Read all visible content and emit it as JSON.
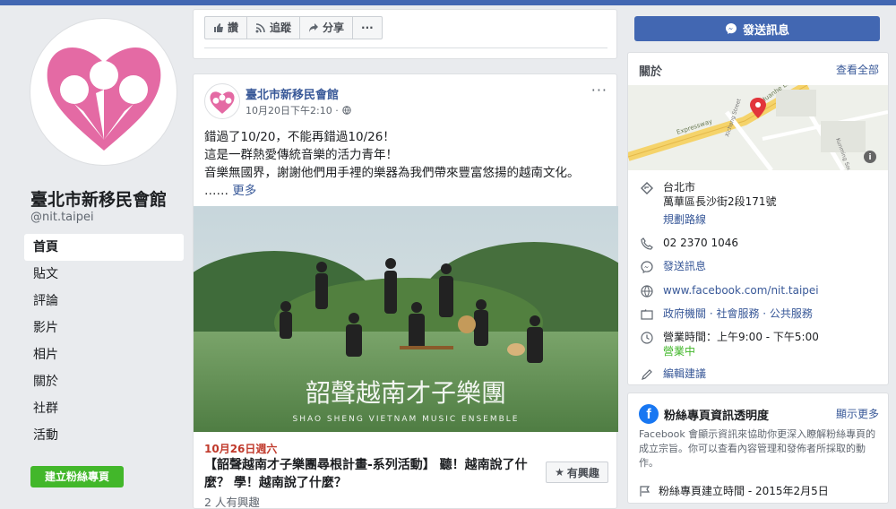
{
  "colors": {
    "brand": "#4267b2",
    "link": "#385898",
    "accent_pink": "#e46aa4",
    "green": "#42b72a",
    "event_red": "#c0392b"
  },
  "sidebar": {
    "page_name": "臺北市新移民會館",
    "handle": "@nit.taipei",
    "items": [
      {
        "label": "首頁"
      },
      {
        "label": "貼文"
      },
      {
        "label": "評論"
      },
      {
        "label": "影片"
      },
      {
        "label": "相片"
      },
      {
        "label": "關於"
      },
      {
        "label": "社群"
      },
      {
        "label": "活動"
      }
    ],
    "create_page": "建立粉絲專頁"
  },
  "actions": {
    "like": "讚",
    "follow": "追蹤",
    "share": "分享",
    "more": "···"
  },
  "post": {
    "author": "臺北市新移民會館",
    "time": "10月20日下午2:10 · ",
    "more": "···",
    "line1": "錯過了10/20，不能再錯過10/26！",
    "line2": "這是一群熱愛傳統音樂的活力青年！",
    "line3": "音樂無國界，謝謝他們用手裡的樂器為我們帶來豐富悠揚的越南文化。",
    "line4_prefix": "…… ",
    "line4_link": "更多",
    "image_title": "韶聲越南才子樂團",
    "image_subtitle": "SHAO SHENG VIETNAM MUSIC ENSEMBLE",
    "event_date": "10月26日週六",
    "event_title": "【韶聲越南才子樂團尋根計畫-系列活動】 聽！越南說了什麼？ 學！越南說了什麼？",
    "interest_btn": "有興趣",
    "interest_count": "2 人有興趣"
  },
  "right": {
    "message_btn": "發送訊息",
    "about_title": "關於",
    "see_all": "查看全部",
    "map_labels": {
      "road1": "Huanhe Express",
      "road2": "Expressway",
      "road3": "Xichang Street",
      "road4": "Kunming South Road"
    },
    "address_city": "台北市",
    "address_street": "萬華區長沙街2段171號",
    "directions": "規劃路線",
    "phone": "02 2370 1046",
    "send_message": "發送訊息",
    "website": "www.facebook.com/nit.taipei",
    "categories": "政府機關 · 社會服務 · 公共服務",
    "hours": "營業時間：上午9:00 - 下午5:00",
    "open_status": "營業中",
    "suggest_edit": "編輯建議",
    "transparency_title": "粉絲專頁資訊透明度",
    "transparency_more": "顯示更多",
    "transparency_body": "Facebook 會顯示資訊來協助你更深入瞭解粉絲專頁的成立宗旨。你可以查看內容管理和發佈者所採取的動作。",
    "created": "粉絲專頁建立時間 - 2015年2月5日"
  }
}
